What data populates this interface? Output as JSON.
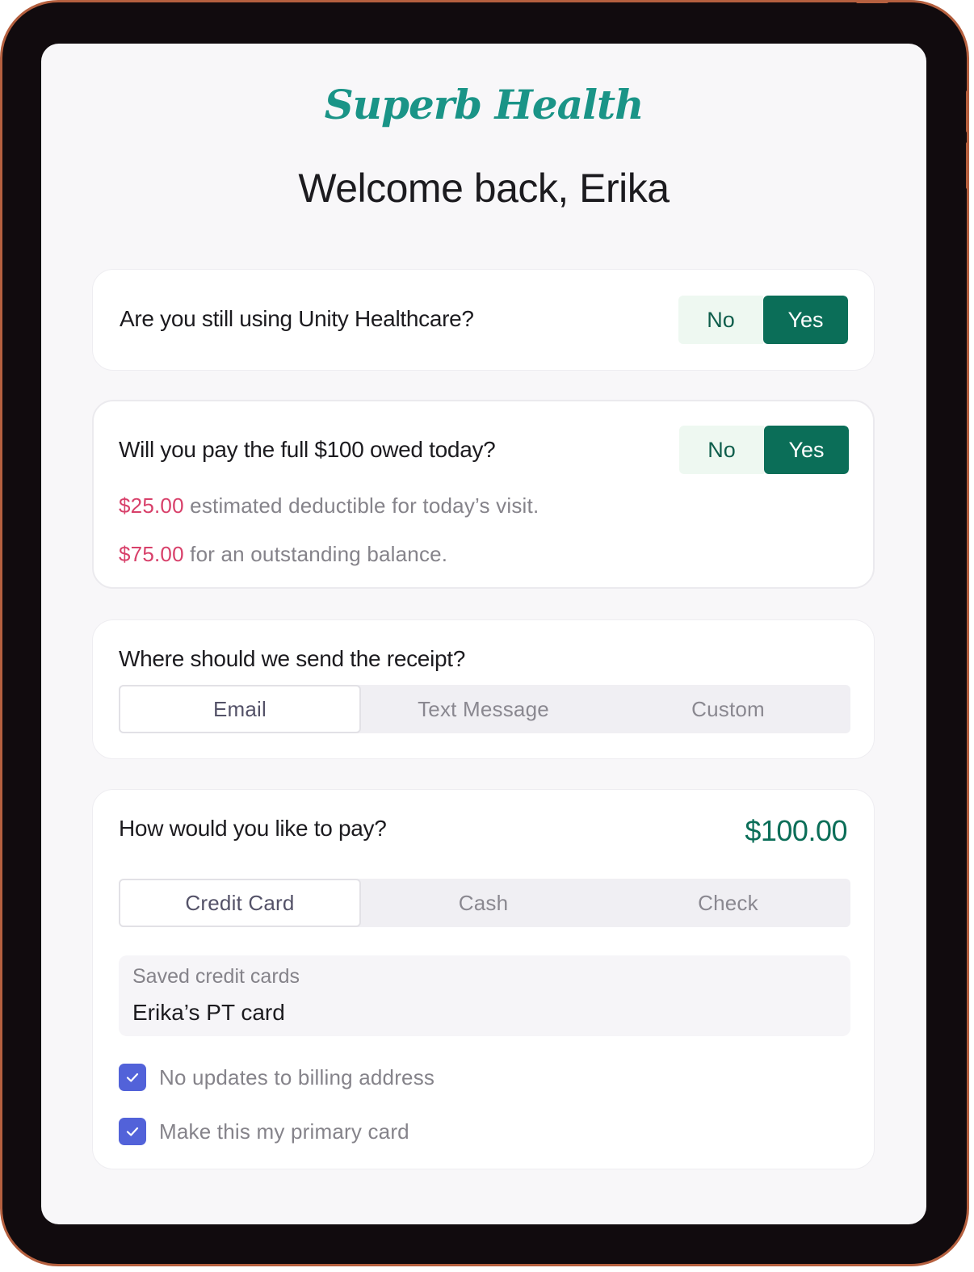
{
  "app": {
    "logo": "Superb Health",
    "welcome": "Welcome back, Erika"
  },
  "insurance": {
    "question": "Are you still using Unity Healthcare?",
    "no_label": "No",
    "yes_label": "Yes",
    "selected": "Yes"
  },
  "payment_today": {
    "question": "Will you pay the full $100 owed today?",
    "no_label": "No",
    "yes_label": "Yes",
    "selected": "Yes",
    "deductible_amount": "$25.00",
    "deductible_text": " estimated deductible for today’s visit.",
    "balance_amount": "$75.00",
    "balance_text": " for an outstanding balance."
  },
  "receipt": {
    "question": "Where should we send the receipt?",
    "options": [
      "Email",
      "Text Message",
      "Custom"
    ],
    "selected": "Email"
  },
  "pay_method": {
    "question": "How would you like to pay?",
    "total": "$100.00",
    "options": [
      "Credit Card",
      "Cash",
      "Check"
    ],
    "selected": "Credit Card",
    "saved_cards_label": "Saved credit cards",
    "saved_card_value": "Erika’s PT card",
    "checkboxes": [
      {
        "label": "No updates to billing address",
        "checked": true
      },
      {
        "label": "Make this my primary card",
        "checked": true
      }
    ]
  },
  "colors": {
    "brand": "#1a9487",
    "primary": "#0b6e58",
    "amount": "#d8406a",
    "checkbox": "#5262d9",
    "bezel_trim": "#b5603f"
  }
}
